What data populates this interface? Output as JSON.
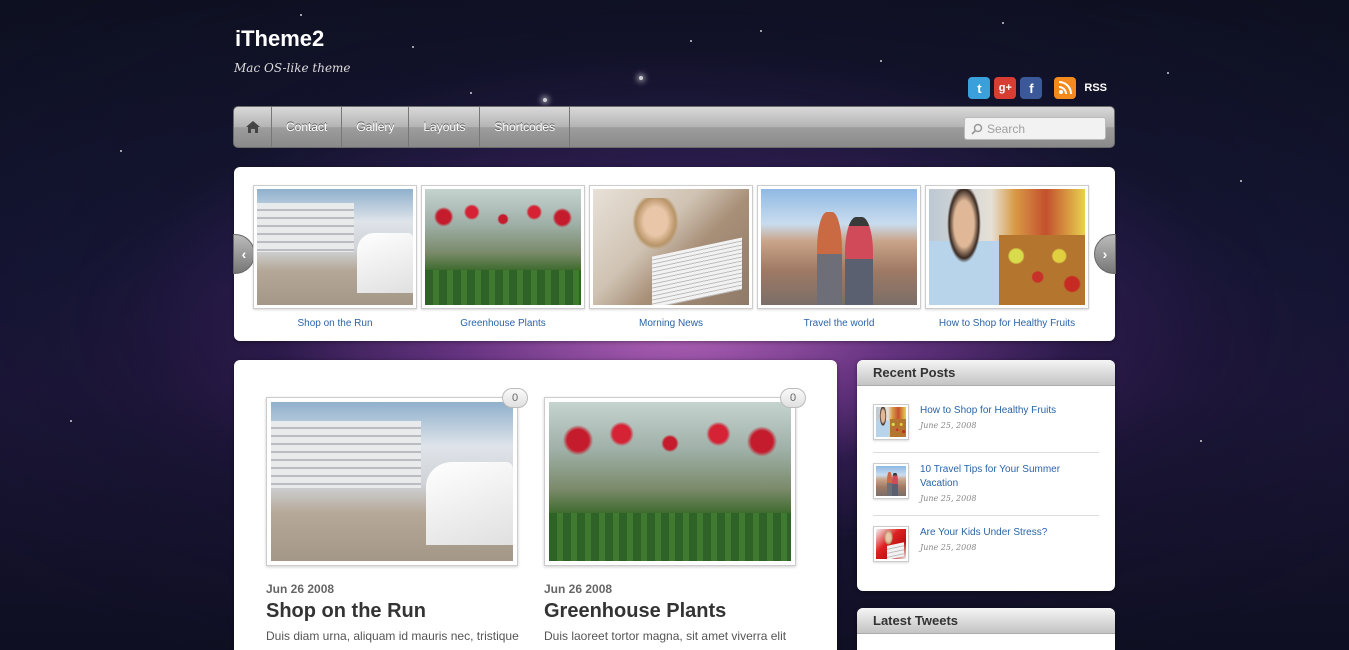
{
  "site": {
    "title": "iTheme2",
    "tagline": "Mac OS-like theme"
  },
  "social": {
    "rss_label": "RSS",
    "icons": [
      "twitter-icon",
      "google-plus-icon",
      "facebook-icon",
      "rss-icon"
    ]
  },
  "nav": {
    "items": [
      {
        "label": "Contact"
      },
      {
        "label": "Gallery"
      },
      {
        "label": "Layouts"
      },
      {
        "label": "Shortcodes"
      }
    ],
    "search_placeholder": "Search"
  },
  "slider": {
    "slides": [
      {
        "caption": "Shop on the Run"
      },
      {
        "caption": "Greenhouse Plants"
      },
      {
        "caption": "Morning News"
      },
      {
        "caption": "Travel the world"
      },
      {
        "caption": "How to Shop for Healthy Fruits"
      }
    ]
  },
  "posts": [
    {
      "date": "Jun 26 2008",
      "title": "Shop on the Run",
      "excerpt": "Duis diam urna, aliquam id mauris nec, tristique",
      "comments": "0"
    },
    {
      "date": "Jun 26 2008",
      "title": "Greenhouse Plants",
      "excerpt": "Duis laoreet tortor magna, sit amet viverra elit",
      "comments": "0"
    }
  ],
  "sidebar": {
    "recent_posts": {
      "heading": "Recent Posts",
      "items": [
        {
          "title": "How to Shop for Healthy Fruits",
          "date": "June 25, 2008"
        },
        {
          "title": "10 Travel Tips for Your Summer Vacation",
          "date": "June 25, 2008"
        },
        {
          "title": "Are Your Kids Under Stress?",
          "date": "June 25, 2008"
        }
      ]
    },
    "latest_tweets": {
      "heading": "Latest Tweets"
    }
  }
}
